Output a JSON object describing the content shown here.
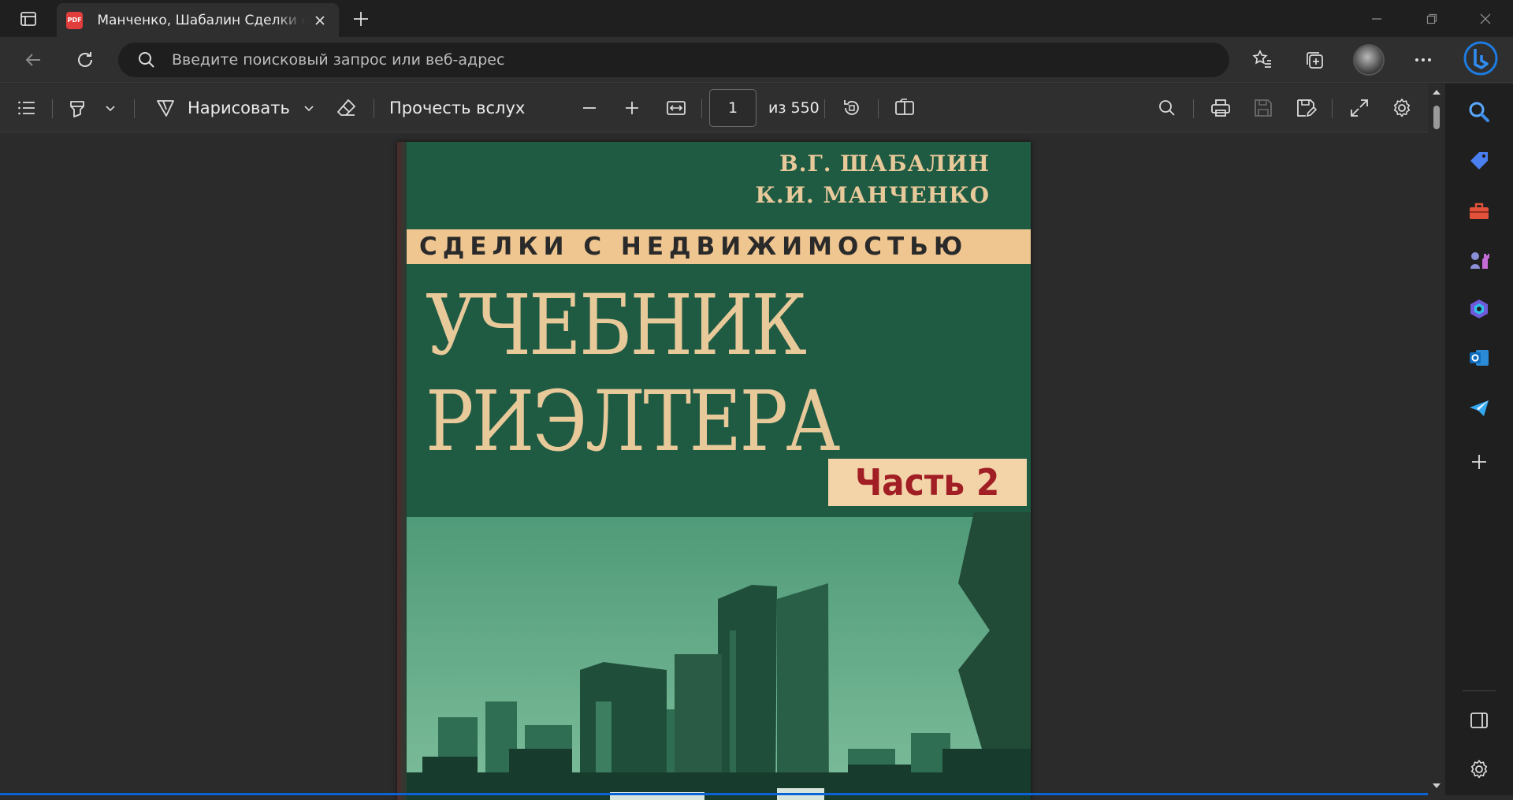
{
  "browser": {
    "tab": {
      "title": "Манченко, Шабалин Сделки с недвижимостью",
      "favicon_label": "PDF"
    },
    "address_bar": {
      "placeholder": "Введите поисковый запрос или веб-адрес",
      "value": ""
    }
  },
  "pdf_toolbar": {
    "draw_label": "Нарисовать",
    "read_aloud_label": "Прочесть вслух",
    "current_page": "1",
    "page_count_label": "из 550"
  },
  "document": {
    "authors": [
      "В.Г. ШАБАЛИН",
      "К.И. МАНЧЕНКО"
    ],
    "series": "СДЕЛКИ С НЕДВИЖИМОСТЬЮ",
    "title_lines": [
      "УЧЕБНИК",
      "РИЭЛТЕРА"
    ],
    "part": "Часть 2"
  },
  "colors": {
    "cover_green": "#1f5a43",
    "cover_band": "#efc590",
    "title_color": "#e8c99a",
    "part_red": "#a11e24",
    "edge_accent": "#0a64d8"
  }
}
